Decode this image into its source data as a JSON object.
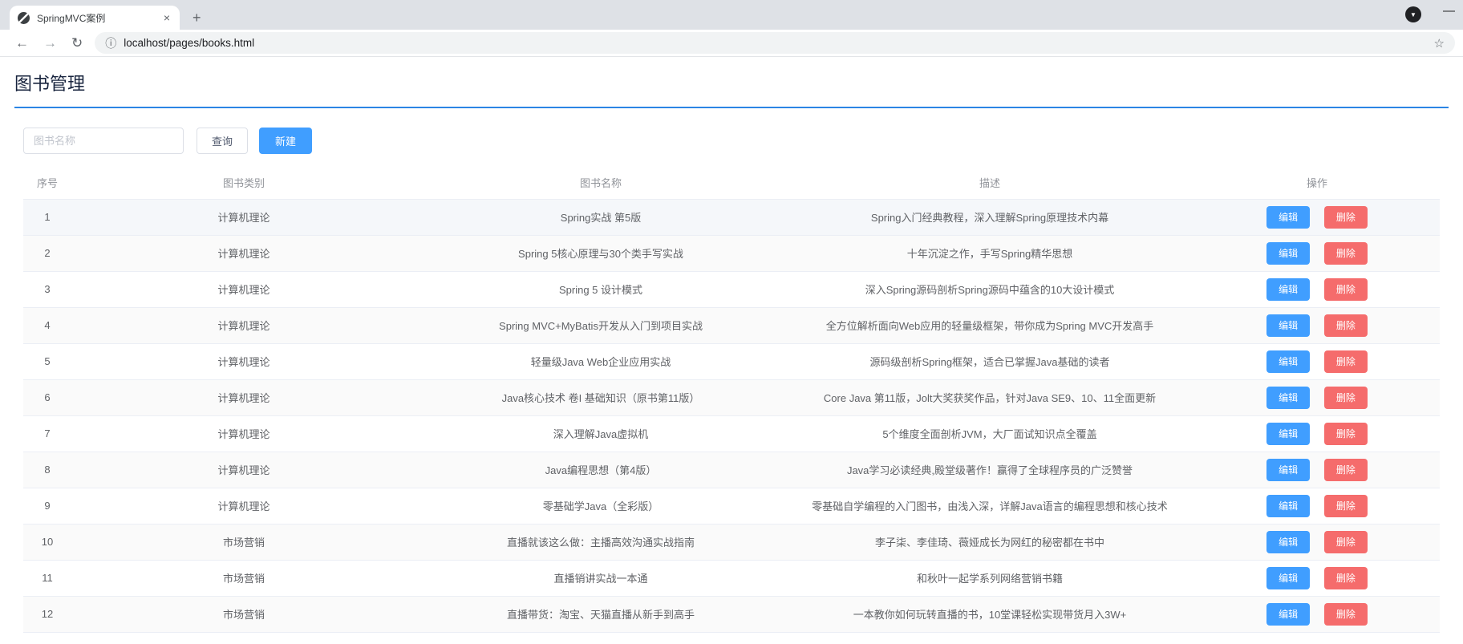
{
  "browser": {
    "tab_title": "SpringMVC案例",
    "url": "localhost/pages/books.html",
    "icons": {
      "close_tab": "×",
      "new_tab": "+",
      "back": "←",
      "forward": "→",
      "reload": "↻",
      "info": "ⓘ",
      "star": "☆",
      "download": "▼",
      "minimize": "—"
    }
  },
  "page": {
    "title": "图书管理",
    "search_placeholder": "图书名称",
    "query_button": "查询",
    "create_button": "新建"
  },
  "table": {
    "headers": [
      "序号",
      "图书类别",
      "图书名称",
      "描述",
      "操作"
    ],
    "edit_label": "编辑",
    "delete_label": "删除",
    "rows": [
      {
        "id": "1",
        "type": "计算机理论",
        "name": "Spring实战 第5版",
        "desc": "Spring入门经典教程，深入理解Spring原理技术内幕"
      },
      {
        "id": "2",
        "type": "计算机理论",
        "name": "Spring 5核心原理与30个类手写实战",
        "desc": "十年沉淀之作，手写Spring精华思想"
      },
      {
        "id": "3",
        "type": "计算机理论",
        "name": "Spring 5 设计模式",
        "desc": "深入Spring源码剖析Spring源码中蕴含的10大设计模式"
      },
      {
        "id": "4",
        "type": "计算机理论",
        "name": "Spring MVC+MyBatis开发从入门到项目实战",
        "desc": "全方位解析面向Web应用的轻量级框架，带你成为Spring MVC开发高手"
      },
      {
        "id": "5",
        "type": "计算机理论",
        "name": "轻量级Java Web企业应用实战",
        "desc": "源码级剖析Spring框架，适合已掌握Java基础的读者"
      },
      {
        "id": "6",
        "type": "计算机理论",
        "name": "Java核心技术 卷I 基础知识（原书第11版）",
        "desc": "Core Java 第11版，Jolt大奖获奖作品，针对Java SE9、10、11全面更新"
      },
      {
        "id": "7",
        "type": "计算机理论",
        "name": "深入理解Java虚拟机",
        "desc": "5个维度全面剖析JVM，大厂面试知识点全覆盖"
      },
      {
        "id": "8",
        "type": "计算机理论",
        "name": "Java编程思想（第4版）",
        "desc": "Java学习必读经典,殿堂级著作！赢得了全球程序员的广泛赞誉"
      },
      {
        "id": "9",
        "type": "计算机理论",
        "name": "零基础学Java（全彩版）",
        "desc": "零基础自学编程的入门图书，由浅入深，详解Java语言的编程思想和核心技术"
      },
      {
        "id": "10",
        "type": "市场营销",
        "name": "直播就该这么做：主播高效沟通实战指南",
        "desc": "李子柒、李佳琦、薇娅成长为网红的秘密都在书中"
      },
      {
        "id": "11",
        "type": "市场营销",
        "name": "直播销讲实战一本通",
        "desc": "和秋叶一起学系列网络营销书籍"
      },
      {
        "id": "12",
        "type": "市场营销",
        "name": "直播带货：淘宝、天猫直播从新手到高手",
        "desc": "一本教你如何玩转直播的书，10堂课轻松实现带货月入3W+"
      }
    ]
  },
  "colors": {
    "primary": "#409eff",
    "danger": "#f56c6c",
    "title_rule": "#2b85e4",
    "stripe": "#fafafa"
  }
}
